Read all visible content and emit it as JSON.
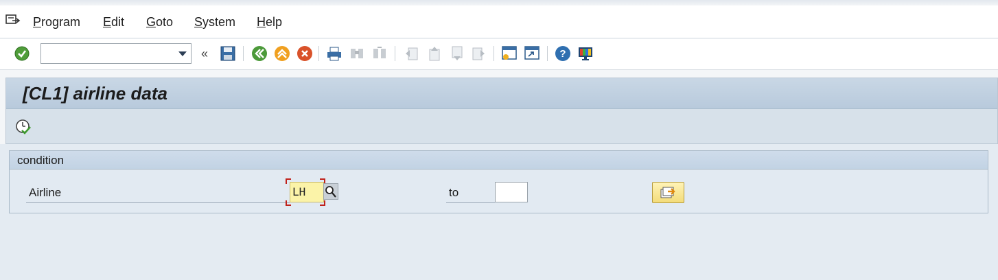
{
  "menubar": {
    "items": [
      {
        "first": "P",
        "rest": "rogram"
      },
      {
        "first": "E",
        "rest": "dit"
      },
      {
        "first": "G",
        "rest": "oto"
      },
      {
        "first": "S",
        "rest": "ystem"
      },
      {
        "first": "H",
        "rest": "elp"
      }
    ]
  },
  "toolbar": {
    "command_field_value": "",
    "icons": [
      "enter-icon",
      "command-field-dropdown",
      "collapse-icon",
      "save-icon",
      "back-icon",
      "exit-icon",
      "cancel-icon",
      "print-icon",
      "find-icon",
      "find-next-icon",
      "first-page-icon",
      "previous-page-icon",
      "next-page-icon",
      "last-page-icon",
      "new-session-icon",
      "shortcut-icon",
      "help-icon",
      "customize-layout-icon"
    ]
  },
  "title": {
    "text": "[CL1] airline data"
  },
  "app_toolbar": {
    "icons": [
      "execute-icon"
    ]
  },
  "selection": {
    "group_title": "condition",
    "field_label": "Airline",
    "low_value": "LH",
    "to_label": "to",
    "high_value": ""
  },
  "colors": {
    "title_band": "#c4d4e4",
    "required_field": "#fbf3a8",
    "focus_corners": "#c0221b"
  }
}
